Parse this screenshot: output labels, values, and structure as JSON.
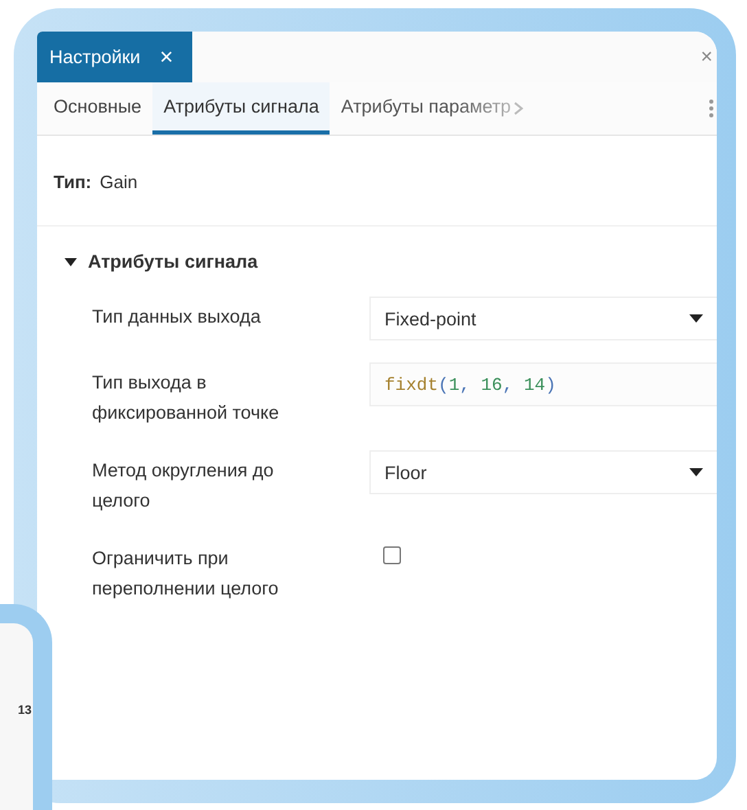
{
  "panel_tab": {
    "label": "Настройки",
    "close": "×"
  },
  "window_close": "×",
  "tabs": [
    {
      "label": "Основные",
      "selected": false
    },
    {
      "label": "Атрибуты сигнала",
      "selected": true
    },
    {
      "label": "Атрибуты параметр",
      "selected": false
    }
  ],
  "block_type": {
    "label": "Тип:",
    "value": "Gain"
  },
  "section": {
    "title": "Атрибуты сигнала",
    "expanded": true,
    "rows": [
      {
        "kind": "dropdown",
        "label": "Тип данных выхода",
        "value": "Fixed-point"
      },
      {
        "kind": "code",
        "label": "Тип выхода в фиксированной точке",
        "value": "fixdt(1, 16, 14)"
      },
      {
        "kind": "dropdown",
        "label": "Метод округления до целого",
        "value": "Floor"
      },
      {
        "kind": "checkbox",
        "label": "Ограничить при переполнении целого",
        "checked": false
      }
    ]
  },
  "background_window": {
    "text": "13"
  }
}
